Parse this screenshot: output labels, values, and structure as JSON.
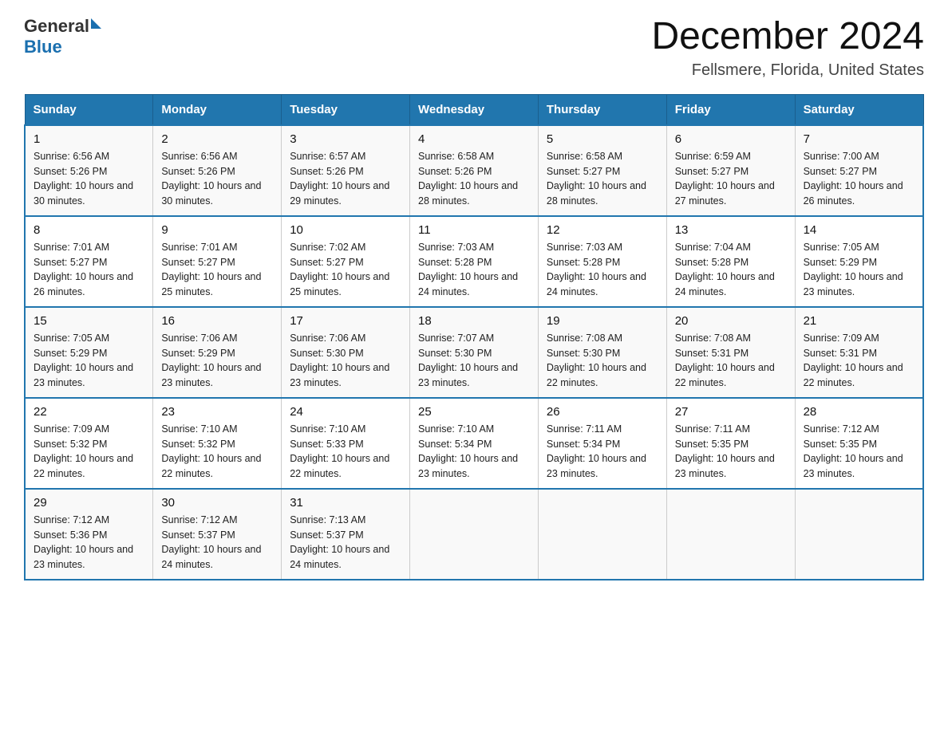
{
  "header": {
    "logo_general": "General",
    "logo_blue": "Blue",
    "title": "December 2024",
    "subtitle": "Fellsmere, Florida, United States"
  },
  "days_of_week": [
    "Sunday",
    "Monday",
    "Tuesday",
    "Wednesday",
    "Thursday",
    "Friday",
    "Saturday"
  ],
  "weeks": [
    [
      {
        "day": "1",
        "sunrise": "6:56 AM",
        "sunset": "5:26 PM",
        "daylight": "10 hours and 30 minutes."
      },
      {
        "day": "2",
        "sunrise": "6:56 AM",
        "sunset": "5:26 PM",
        "daylight": "10 hours and 30 minutes."
      },
      {
        "day": "3",
        "sunrise": "6:57 AM",
        "sunset": "5:26 PM",
        "daylight": "10 hours and 29 minutes."
      },
      {
        "day": "4",
        "sunrise": "6:58 AM",
        "sunset": "5:26 PM",
        "daylight": "10 hours and 28 minutes."
      },
      {
        "day": "5",
        "sunrise": "6:58 AM",
        "sunset": "5:27 PM",
        "daylight": "10 hours and 28 minutes."
      },
      {
        "day": "6",
        "sunrise": "6:59 AM",
        "sunset": "5:27 PM",
        "daylight": "10 hours and 27 minutes."
      },
      {
        "day": "7",
        "sunrise": "7:00 AM",
        "sunset": "5:27 PM",
        "daylight": "10 hours and 26 minutes."
      }
    ],
    [
      {
        "day": "8",
        "sunrise": "7:01 AM",
        "sunset": "5:27 PM",
        "daylight": "10 hours and 26 minutes."
      },
      {
        "day": "9",
        "sunrise": "7:01 AM",
        "sunset": "5:27 PM",
        "daylight": "10 hours and 25 minutes."
      },
      {
        "day": "10",
        "sunrise": "7:02 AM",
        "sunset": "5:27 PM",
        "daylight": "10 hours and 25 minutes."
      },
      {
        "day": "11",
        "sunrise": "7:03 AM",
        "sunset": "5:28 PM",
        "daylight": "10 hours and 24 minutes."
      },
      {
        "day": "12",
        "sunrise": "7:03 AM",
        "sunset": "5:28 PM",
        "daylight": "10 hours and 24 minutes."
      },
      {
        "day": "13",
        "sunrise": "7:04 AM",
        "sunset": "5:28 PM",
        "daylight": "10 hours and 24 minutes."
      },
      {
        "day": "14",
        "sunrise": "7:05 AM",
        "sunset": "5:29 PM",
        "daylight": "10 hours and 23 minutes."
      }
    ],
    [
      {
        "day": "15",
        "sunrise": "7:05 AM",
        "sunset": "5:29 PM",
        "daylight": "10 hours and 23 minutes."
      },
      {
        "day": "16",
        "sunrise": "7:06 AM",
        "sunset": "5:29 PM",
        "daylight": "10 hours and 23 minutes."
      },
      {
        "day": "17",
        "sunrise": "7:06 AM",
        "sunset": "5:30 PM",
        "daylight": "10 hours and 23 minutes."
      },
      {
        "day": "18",
        "sunrise": "7:07 AM",
        "sunset": "5:30 PM",
        "daylight": "10 hours and 23 minutes."
      },
      {
        "day": "19",
        "sunrise": "7:08 AM",
        "sunset": "5:30 PM",
        "daylight": "10 hours and 22 minutes."
      },
      {
        "day": "20",
        "sunrise": "7:08 AM",
        "sunset": "5:31 PM",
        "daylight": "10 hours and 22 minutes."
      },
      {
        "day": "21",
        "sunrise": "7:09 AM",
        "sunset": "5:31 PM",
        "daylight": "10 hours and 22 minutes."
      }
    ],
    [
      {
        "day": "22",
        "sunrise": "7:09 AM",
        "sunset": "5:32 PM",
        "daylight": "10 hours and 22 minutes."
      },
      {
        "day": "23",
        "sunrise": "7:10 AM",
        "sunset": "5:32 PM",
        "daylight": "10 hours and 22 minutes."
      },
      {
        "day": "24",
        "sunrise": "7:10 AM",
        "sunset": "5:33 PM",
        "daylight": "10 hours and 22 minutes."
      },
      {
        "day": "25",
        "sunrise": "7:10 AM",
        "sunset": "5:34 PM",
        "daylight": "10 hours and 23 minutes."
      },
      {
        "day": "26",
        "sunrise": "7:11 AM",
        "sunset": "5:34 PM",
        "daylight": "10 hours and 23 minutes."
      },
      {
        "day": "27",
        "sunrise": "7:11 AM",
        "sunset": "5:35 PM",
        "daylight": "10 hours and 23 minutes."
      },
      {
        "day": "28",
        "sunrise": "7:12 AM",
        "sunset": "5:35 PM",
        "daylight": "10 hours and 23 minutes."
      }
    ],
    [
      {
        "day": "29",
        "sunrise": "7:12 AM",
        "sunset": "5:36 PM",
        "daylight": "10 hours and 23 minutes."
      },
      {
        "day": "30",
        "sunrise": "7:12 AM",
        "sunset": "5:37 PM",
        "daylight": "10 hours and 24 minutes."
      },
      {
        "day": "31",
        "sunrise": "7:13 AM",
        "sunset": "5:37 PM",
        "daylight": "10 hours and 24 minutes."
      },
      null,
      null,
      null,
      null
    ]
  ],
  "labels": {
    "sunrise_prefix": "Sunrise: ",
    "sunset_prefix": "Sunset: ",
    "daylight_prefix": "Daylight: "
  }
}
